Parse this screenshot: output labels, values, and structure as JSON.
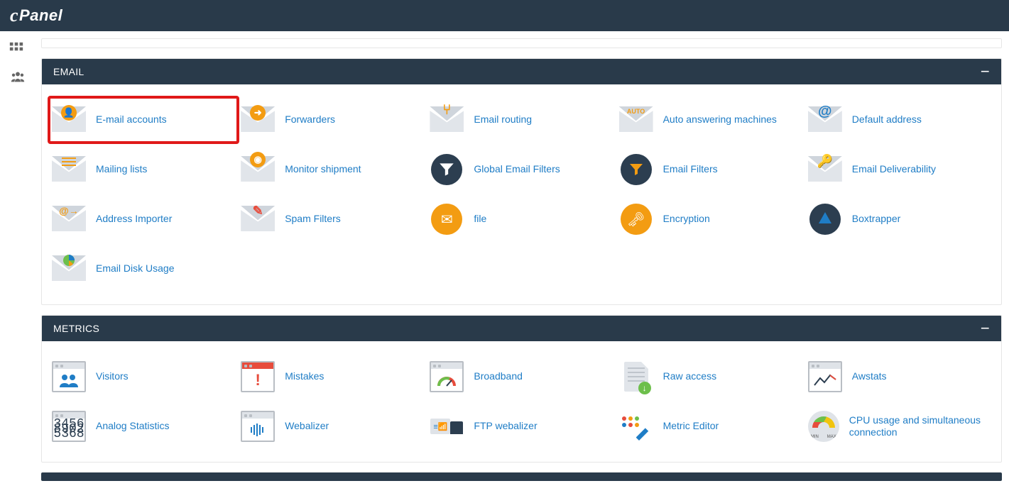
{
  "brand": "cPanel",
  "sections": {
    "email": {
      "title": "EMAIL",
      "items": [
        {
          "label": "E-mail accounts",
          "icon": "env-user",
          "highlight": true
        },
        {
          "label": "Forwarders",
          "icon": "env-arrow"
        },
        {
          "label": "Email routing",
          "icon": "env-split"
        },
        {
          "label": "Auto answering machines",
          "icon": "env-auto"
        },
        {
          "label": "Default address",
          "icon": "env-at"
        },
        {
          "label": "Mailing lists",
          "icon": "env-list"
        },
        {
          "label": "Monitor shipment",
          "icon": "env-pin"
        },
        {
          "label": "Global Email Filters",
          "icon": "circ-funnel-globe"
        },
        {
          "label": "Email Filters",
          "icon": "circ-funnel"
        },
        {
          "label": "Email Deliverability",
          "icon": "env-key"
        },
        {
          "label": "Address Importer",
          "icon": "env-atarrow"
        },
        {
          "label": "Spam Filters",
          "icon": "env-pencil"
        },
        {
          "label": "file",
          "icon": "circ-mail"
        },
        {
          "label": "Encryption",
          "icon": "circ-keylock"
        },
        {
          "label": "Boxtrapper",
          "icon": "circ-trap"
        },
        {
          "label": "Email Disk Usage",
          "icon": "env-pie"
        }
      ]
    },
    "metrics": {
      "title": "METRICS",
      "items": [
        {
          "label": "Visitors",
          "icon": "win-users"
        },
        {
          "label": "Mistakes",
          "icon": "win-error"
        },
        {
          "label": "Broadband",
          "icon": "win-gauge"
        },
        {
          "label": "Raw access",
          "icon": "doc-dl"
        },
        {
          "label": "Awstats",
          "icon": "win-line"
        },
        {
          "label": "Analog Statistics",
          "icon": "win-numbers"
        },
        {
          "label": "Webalizer",
          "icon": "win-wave"
        },
        {
          "label": "FTP webalizer",
          "icon": "truck"
        },
        {
          "label": "Metric Editor",
          "icon": "editor"
        },
        {
          "label": "CPU usage and simultaneous connection",
          "icon": "gauge"
        }
      ]
    }
  }
}
